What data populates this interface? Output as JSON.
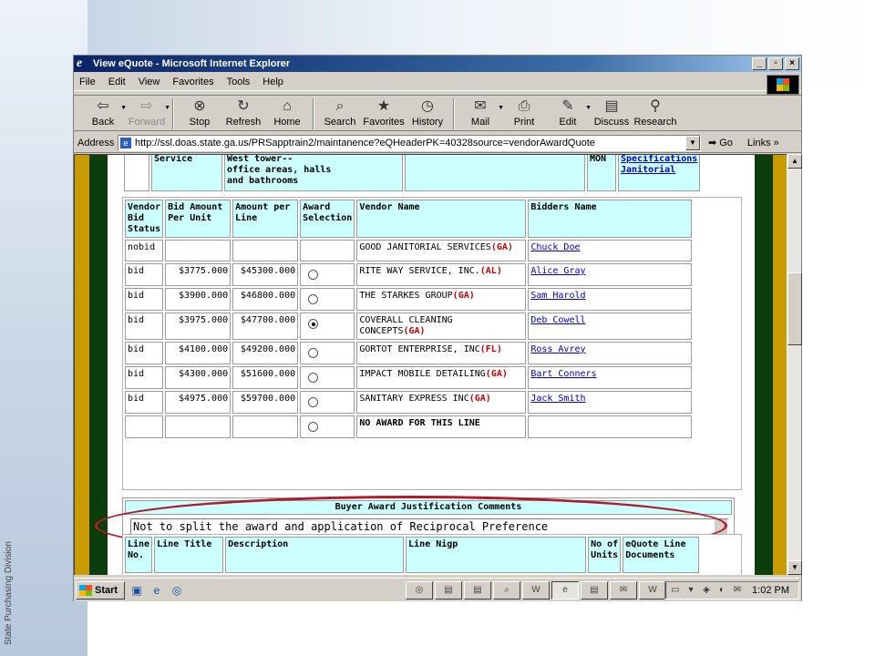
{
  "slide": {
    "caption": "State Purchasing Division"
  },
  "window": {
    "title": "View eQuote - Microsoft Internet Explorer",
    "menu": [
      "File",
      "Edit",
      "View",
      "Favorites",
      "Tools",
      "Help"
    ],
    "toolbar": [
      {
        "label": "Back",
        "icon": "back-arrow-icon",
        "glyph": "⇦"
      },
      {
        "label": "Forward",
        "icon": "forward-arrow-icon",
        "glyph": "⇨"
      },
      {
        "label": "Stop",
        "icon": "stop-icon",
        "glyph": "⊗"
      },
      {
        "label": "Refresh",
        "icon": "refresh-icon",
        "glyph": "↻"
      },
      {
        "label": "Home",
        "icon": "home-icon",
        "glyph": "⌂"
      },
      {
        "label": "Search",
        "icon": "search-icon",
        "glyph": "⌕"
      },
      {
        "label": "Favorites",
        "icon": "favorites-icon",
        "glyph": "★"
      },
      {
        "label": "History",
        "icon": "history-icon",
        "glyph": "◷"
      },
      {
        "label": "Mail",
        "icon": "mail-icon",
        "glyph": "✉"
      },
      {
        "label": "Print",
        "icon": "print-icon",
        "glyph": "⎙"
      },
      {
        "label": "Edit",
        "icon": "edit-icon",
        "glyph": "✎"
      },
      {
        "label": "Discuss",
        "icon": "discuss-icon",
        "glyph": "▤"
      },
      {
        "label": "Research",
        "icon": "research-icon",
        "glyph": "⚲"
      }
    ],
    "address": {
      "label": "Address",
      "url": "http://ssl.doas.state.ga.us/PRSapptrain2/maintanence?eQHeaderPK=40328source=vendorAwardQuote",
      "go": "Go",
      "links": "Links"
    }
  },
  "top_row": {
    "service": "Service",
    "description": "West tower--\noffice areas, halls\nand bathrooms",
    "unit": "MON",
    "doc1": "Specifications",
    "doc2": "Janitorial"
  },
  "bids": {
    "headers": [
      "Vendor Bid Status",
      "Bid Amount Per Unit",
      "Amount per Line",
      "Award Selection",
      "Vendor Name",
      "Bidders Name"
    ],
    "rows": [
      {
        "status": "nobid",
        "unit": "",
        "line": "",
        "radio": false,
        "selected": false,
        "vendor": "GOOD JANITORIAL SERVICES",
        "state": "(GA)",
        "bidder": "Chuck Doe"
      },
      {
        "status": "bid",
        "unit": "$3775.000",
        "line": "$45300.000",
        "radio": true,
        "selected": false,
        "vendor": "RITE WAY SERVICE, INC.",
        "state": "(AL)",
        "bidder": "Alice Gray"
      },
      {
        "status": "bid",
        "unit": "$3900.000",
        "line": "$46800.000",
        "radio": true,
        "selected": false,
        "vendor": "THE STARKES GROUP",
        "state": "(GA)",
        "bidder": "Sam Harold"
      },
      {
        "status": "bid",
        "unit": "$3975.000",
        "line": "$47700.000",
        "radio": true,
        "selected": true,
        "vendor": "COVERALL CLEANING CONCEPTS",
        "state": "(GA)",
        "bidder": "Deb Cowell"
      },
      {
        "status": "bid",
        "unit": "$4100.000",
        "line": "$49200.000",
        "radio": true,
        "selected": false,
        "vendor": "GORTOT ENTERPRISE, INC",
        "state": "(FL)",
        "bidder": "Ross Avrey"
      },
      {
        "status": "bid",
        "unit": "$4300.000",
        "line": "$51600.000",
        "radio": true,
        "selected": false,
        "vendor": "IMPACT MOBILE DETAILING",
        "state": "(GA)",
        "bidder": "Bart Conners"
      },
      {
        "status": "bid",
        "unit": "$4975.000",
        "line": "$59700.000",
        "radio": true,
        "selected": false,
        "vendor": "SANITARY EXPRESS INC",
        "state": "(GA)",
        "bidder": "Jack Smith"
      },
      {
        "status": "",
        "unit": "",
        "line": "",
        "radio": true,
        "selected": false,
        "vendor": "NO AWARD FOR THIS LINE",
        "state": "",
        "bidder": "",
        "bold": true
      }
    ]
  },
  "comments": {
    "header": "Buyer Award Justification Comments",
    "text": "Not to split the award and application of Reciprocal Preference"
  },
  "line_table": {
    "headers": [
      "Line No.",
      "Line Title",
      "Description",
      "Line Nigp",
      "No of Units",
      "eQuote Line Documents"
    ]
  },
  "taskbar": {
    "start": "Start",
    "clock": "1:02 PM"
  },
  "colors": {
    "title_start": "#0a246a",
    "header_cell": "#ccffff",
    "state_code": "#cc0000",
    "link": "#0000cc",
    "oval": "#b31b2c",
    "stripe_green": "#0c3d0c",
    "stripe_gold": "#c89b00"
  }
}
